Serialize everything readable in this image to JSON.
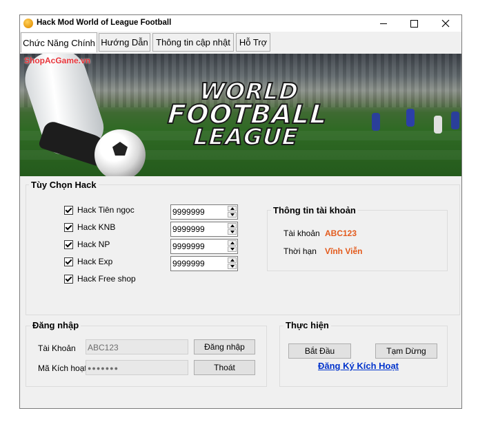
{
  "window": {
    "title": "Hack Mod World of League Football"
  },
  "tabs": [
    {
      "label": "Chức Năng Chính"
    },
    {
      "label": "Hướng Dẫn"
    },
    {
      "label": "Thông tin cập nhật"
    },
    {
      "label": "Hỗ Trợ"
    }
  ],
  "banner": {
    "watermark": "ShopAcGame.vn",
    "logo_line1": "WORLD",
    "logo_line2": "FOOTBALL",
    "logo_line3": "LEAGUE"
  },
  "hack_options": {
    "title": "Tùy Chọn Hack",
    "items": [
      {
        "label": "Hack Tiên ngọc",
        "checked": true,
        "value": "9999999"
      },
      {
        "label": "Hack KNB",
        "checked": true,
        "value": "9999999"
      },
      {
        "label": "Hack NP",
        "checked": true,
        "value": "9999999"
      },
      {
        "label": "Hack Exp",
        "checked": true,
        "value": "9999999"
      },
      {
        "label": "Hack Free shop",
        "checked": true
      }
    ]
  },
  "account_info": {
    "title": "Thông tin tài khoản",
    "account_label": "Tài khoản",
    "account_value": "ABC123",
    "term_label": "Thời hạn",
    "term_value": "Vĩnh Viễn",
    "value_color": "#e35a1c"
  },
  "login": {
    "title": "Đăng nhập",
    "account_label": "Tài Khoản",
    "account_value": "ABC123",
    "code_label": "Mã Kích hoạt",
    "code_value": "●●●●●●●",
    "login_button": "Đăng nhập",
    "exit_button": "Thoát"
  },
  "actions": {
    "title": "Thực hiện",
    "start_button": "Bắt Đầu",
    "pause_button": "Tạm Dừng",
    "register_link": "Đăng Ký Kích Hoạt",
    "link_color": "#0033cc"
  }
}
